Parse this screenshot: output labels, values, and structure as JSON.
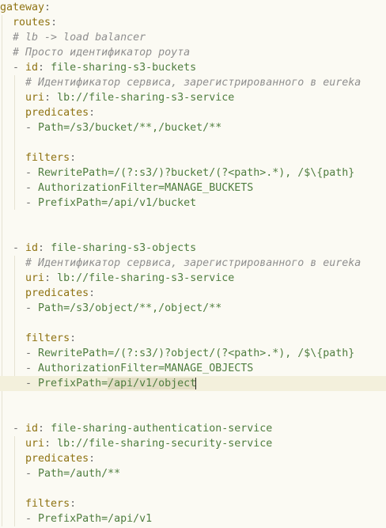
{
  "colors": {
    "background": "#fbfaf3",
    "key": "#8f7312",
    "comment": "#8f8f8f",
    "value": "#4f7d3f",
    "current_line": "#f3f0dc",
    "selection": "#e3dec5"
  },
  "code": {
    "gateway_key": "gateway",
    "routes_key": "routes",
    "comment_lb": "# lb -> load balancer",
    "comment_route_id": "# Просто идентификатор роута",
    "routes": [
      {
        "id_key": "id",
        "id": "file-sharing-s3-buckets",
        "comment_service": "# Идентификатор сервиса, зарегистрированного в eureka",
        "uri_key": "uri",
        "uri": "lb://file-sharing-s3-service",
        "predicates_key": "predicates",
        "predicate_1": "Path=/s3/bucket/**,/bucket/**",
        "filters_key": "filters",
        "filter_1": "RewritePath=/(?:s3/)?bucket/(?<path>.*), /$\\{path}",
        "filter_2": "AuthorizationFilter=MANAGE_BUCKETS",
        "filter_3": "PrefixPath=/api/v1/bucket"
      },
      {
        "id_key": "id",
        "id": "file-sharing-s3-objects",
        "comment_service": "# Идентификатор сервиса, зарегистрированного в eureka",
        "uri_key": "uri",
        "uri": "lb://file-sharing-s3-service",
        "predicates_key": "predicates",
        "predicate_1": "Path=/s3/object/**,/object/**",
        "filters_key": "filters",
        "filter_1": "RewritePath=/(?:s3/)?object/(?<path>.*), /$\\{path}",
        "filter_2": "AuthorizationFilter=MANAGE_OBJECTS",
        "filter_3_prefix": "PrefixPath=",
        "filter_3_selected": "/api/v1/object"
      },
      {
        "id_key": "id",
        "id": "file-sharing-authentication-service",
        "uri_key": "uri",
        "uri": "lb://file-sharing-security-service",
        "predicates_key": "predicates",
        "predicate_1": "Path=/auth/**",
        "filters_key": "filters",
        "filter_1": "PrefixPath=/api/v1"
      }
    ]
  }
}
